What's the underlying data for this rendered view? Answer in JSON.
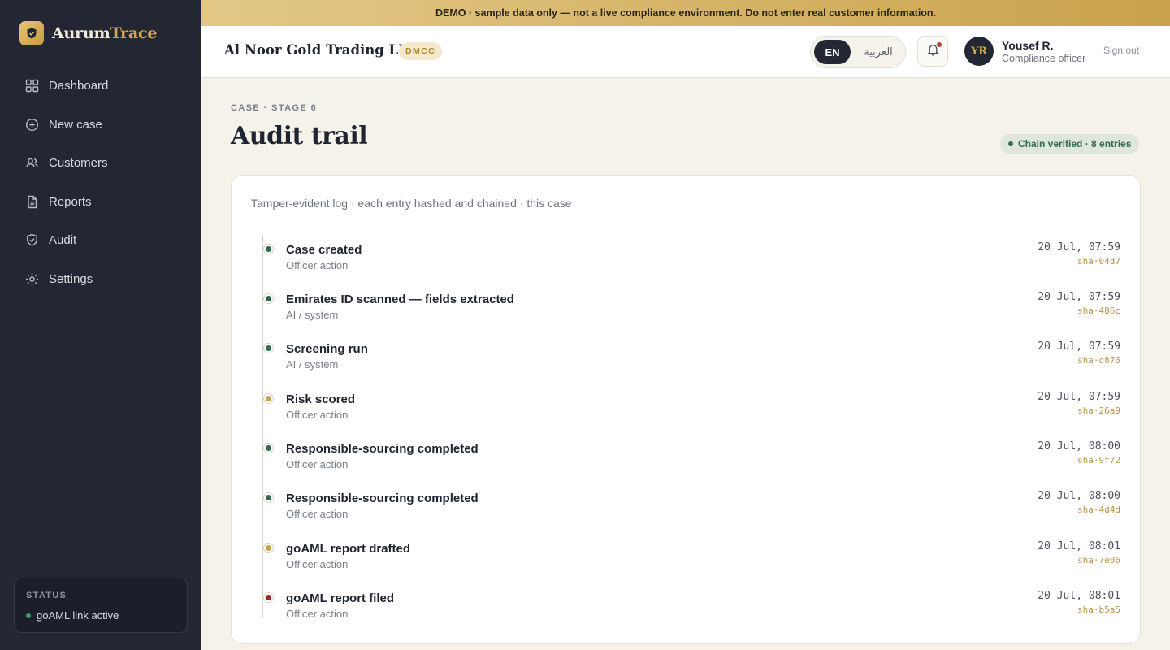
{
  "brand": {
    "name_part1": "Aurum",
    "name_part2": "Trace"
  },
  "sidebar": {
    "items": [
      {
        "label": "Dashboard",
        "icon": "grid-icon"
      },
      {
        "label": "New case",
        "icon": "plus-circle-icon"
      },
      {
        "label": "Customers",
        "icon": "users-icon"
      },
      {
        "label": "Reports",
        "icon": "document-icon"
      },
      {
        "label": "Audit",
        "icon": "shield-check-icon"
      },
      {
        "label": "Settings",
        "icon": "gear-icon"
      }
    ],
    "status": {
      "title": "STATUS",
      "text": "goAML link active",
      "color": "#3f9b6c"
    }
  },
  "banner": {
    "text": "DEMO · sample data only — not a live compliance environment. Do not enter real customer information."
  },
  "header": {
    "company": "Al Noor Gold Trading LLC",
    "company_tag": "DMCC",
    "lang_en": "EN",
    "lang_ar": "العربية",
    "user": {
      "initials": "YR",
      "name": "Yousef R.",
      "role": "Compliance officer"
    },
    "signout": "Sign out"
  },
  "main": {
    "eyebrow": "CASE · STAGE 6",
    "title": "Audit trail",
    "verified": "Chain verified · 8 entries",
    "subtitle": "Tamper-evident log · each entry hashed and chained · this case"
  },
  "entries": [
    {
      "title": "Case created",
      "actor": "Officer action",
      "time": "20 Jul, 07:59",
      "hash": "sha·04d7",
      "color": "#2f6b4c"
    },
    {
      "title": "Emirates ID scanned — fields extracted",
      "actor": "AI / system",
      "time": "20 Jul, 07:59",
      "hash": "sha·486c",
      "color": "#2f6b4c"
    },
    {
      "title": "Screening run",
      "actor": "AI / system",
      "time": "20 Jul, 07:59",
      "hash": "sha·d876",
      "color": "#2f6b4c"
    },
    {
      "title": "Risk scored",
      "actor": "Officer action",
      "time": "20 Jul, 07:59",
      "hash": "sha·26a9",
      "color": "#c9a24b"
    },
    {
      "title": "Responsible-sourcing completed",
      "actor": "Officer action",
      "time": "20 Jul, 08:00",
      "hash": "sha·9f72",
      "color": "#2f6b4c"
    },
    {
      "title": "Responsible-sourcing completed",
      "actor": "Officer action",
      "time": "20 Jul, 08:00",
      "hash": "sha·4d4d",
      "color": "#2f6b4c"
    },
    {
      "title": "goAML report drafted",
      "actor": "Officer action",
      "time": "20 Jul, 08:01",
      "hash": "sha·7e06",
      "color": "#c9a24b"
    },
    {
      "title": "goAML report filed",
      "actor": "Officer action",
      "time": "20 Jul, 08:01",
      "hash": "sha·b5a5",
      "color": "#9b2c22"
    }
  ]
}
